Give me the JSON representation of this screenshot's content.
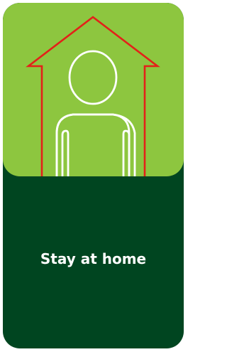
{
  "card": {
    "caption": "Stay at home"
  },
  "icons": {
    "house": "house-outline-icon",
    "person": "person-outline-icon"
  },
  "colors": {
    "top_panel": "#8dc63f",
    "bottom_panel": "#004520",
    "house_stroke": "#e32119",
    "person_stroke": "#ffffff",
    "caption_text": "#ffffff"
  }
}
